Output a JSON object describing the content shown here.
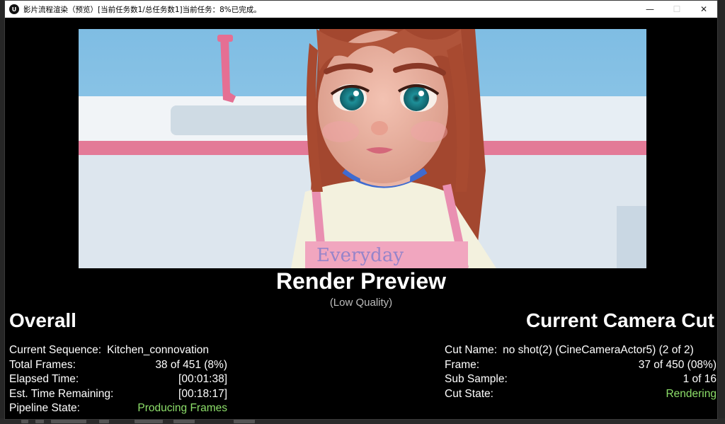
{
  "window": {
    "title": "影片流程渲染（预览）[当前任务数1/总任务数1]当前任务：8%已完成。",
    "icon": "unreal-logo-icon",
    "controls": {
      "minimize": "—",
      "maximize": "☐",
      "close": "✕"
    }
  },
  "preview": {
    "title": "Render Preview",
    "subtitle": "(Low Quality)"
  },
  "overall": {
    "heading": "Overall",
    "current_sequence_label": "Current Sequence:",
    "current_sequence_value": "Kitchen_connovation",
    "total_frames_label": "Total Frames:",
    "total_frames_value": "38 of 451 (8%)",
    "elapsed_time_label": "Elapsed Time:",
    "elapsed_time_value": "[00:01:38]",
    "remaining_label": "Est. Time Remaining:",
    "remaining_value": "[00:18:17]",
    "pipeline_state_label": "Pipeline State:",
    "pipeline_state_value": "Producing Frames"
  },
  "camera_cut": {
    "heading": "Current Camera Cut",
    "cut_name_label": "Cut Name:",
    "cut_name_value": "no shot(2) (CineCameraActor5) (2 of 2)",
    "frame_label": "Frame:",
    "frame_value": "37 of 450 (08%)",
    "sub_sample_label": "Sub Sample:",
    "sub_sample_value": "1 of 16",
    "cut_state_label": "Cut State:",
    "cut_state_value": "Rendering"
  },
  "colors": {
    "status_green": "#8ddf6a",
    "background": "#000000",
    "text": "#ffffff"
  }
}
